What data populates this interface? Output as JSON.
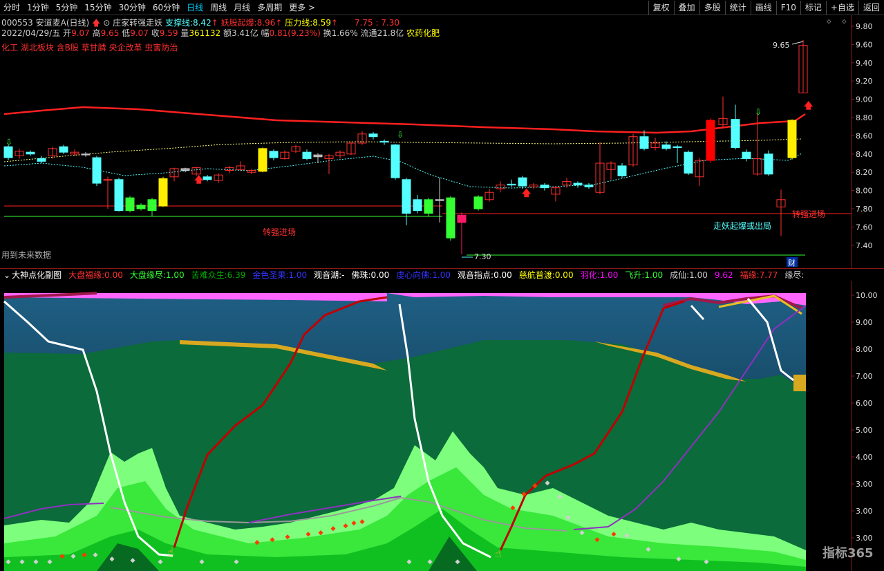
{
  "toolbar": {
    "periods": [
      "分时",
      "1分钟",
      "5分钟",
      "15分钟",
      "30分钟",
      "60分钟",
      "日线",
      "周线",
      "月线",
      "多周期",
      "更多 >"
    ],
    "active_index": 6,
    "right_buttons": [
      "复权",
      "叠加",
      "多股",
      "统计",
      "画线",
      "F10",
      "标记",
      "+自选",
      "返回"
    ]
  },
  "stock": {
    "code_name": "000553 安道麦A(日线)",
    "indicator_name": "庄家转强走妖",
    "support_label": "支撑线:",
    "support_value": "8.42",
    "demon_label": "妖股起爆:",
    "demon_value": "8.96",
    "pressure_label": "压力线:",
    "pressure_value": "8.59",
    "range_text": "7.75 : 7.30",
    "date": "2022/04/29/五",
    "open_label": "开",
    "open": "9.07",
    "high_label": "高",
    "high": "9.65",
    "low_label": "低",
    "low": "9.07",
    "close_label": "收",
    "close": "9.59",
    "vol_label": "量",
    "vol": "361132",
    "amount_label": "额",
    "amount": "3.41亿",
    "change_label": "幅",
    "change": "0.81(9.23%)",
    "turnover_label": "换",
    "turnover": "1.66%",
    "float_label": "流通",
    "float": "21.8亿",
    "industry": "农药化肥",
    "concepts": "化工 湖北板块 含B股 草甘膦 央企改革 虫害防治"
  },
  "annotations": {
    "future_data": "用到未来数据",
    "turn_strong_1": "转强进场",
    "turn_strong_2": "转强进场",
    "exit_label": "走妖起爆或出局",
    "high_mark": "9.65",
    "low_mark": "7.30",
    "fin_badge": "财"
  },
  "main_axis": [
    "9.80",
    "9.60",
    "9.40",
    "9.20",
    "9.00",
    "8.80",
    "8.60",
    "8.40",
    "8.20",
    "8.00",
    "7.80",
    "7.60",
    "7.40"
  ],
  "sub_indicator": {
    "name": "大神点化副图",
    "items": [
      {
        "label": "大盘福缘:",
        "value": "0.00",
        "color": "#ff3030"
      },
      {
        "label": "大盘缘尽:",
        "value": "1.00",
        "color": "#3f3"
      },
      {
        "label": "苦难众生:",
        "value": "6.39",
        "color": "#0a0"
      },
      {
        "label": "金色圣果:",
        "value": "1.00",
        "color": "#33f"
      },
      {
        "label": "观音湖:",
        "value": "-",
        "color": "#fff"
      },
      {
        "label": "佛珠:",
        "value": "0.00",
        "color": "#fff"
      },
      {
        "label": "虔心向佛:",
        "value": "1.00",
        "color": "#33f"
      },
      {
        "label": "观音指点:",
        "value": "0.00",
        "color": "#fff"
      },
      {
        "label": "慈航普渡:",
        "value": "0.00",
        "color": "#ff0"
      },
      {
        "label": "羽化:",
        "value": "1.00",
        "color": "#f0f"
      },
      {
        "label": "飞升:",
        "value": "1.00",
        "color": "#3f3"
      },
      {
        "label": "成仙:",
        "value": "1.00",
        "color": "#ccc"
      },
      {
        "label": "",
        "value": "9.62",
        "color": "#f0f"
      },
      {
        "label": "福缘:",
        "value": "7.77",
        "color": "#ff3030"
      },
      {
        "label": "缘尽:",
        "value": "",
        "color": "#ccc"
      }
    ]
  },
  "sub_axis": [
    "10.00",
    "9.00",
    "8.00",
    "7.00",
    "6.00",
    "5.00",
    "4.00",
    "3.00",
    "3.00",
    "3.00"
  ],
  "watermark": "指标365",
  "colors": {
    "up": "#ff3030",
    "down": "#5ff",
    "support": "#ff2020",
    "accent": "#00d0ff"
  }
}
